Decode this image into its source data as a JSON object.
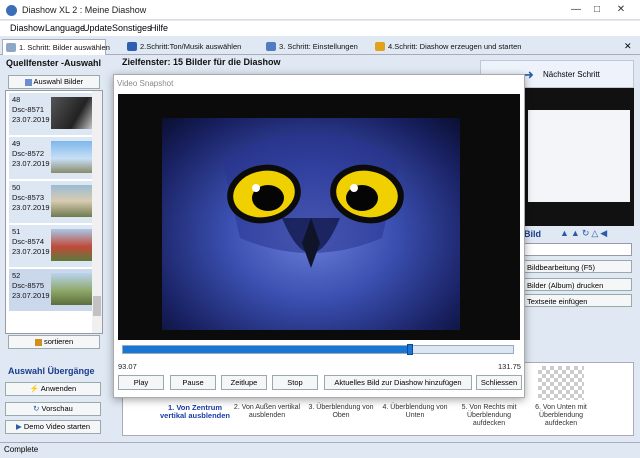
{
  "window": {
    "title": "Diashow XL 2 : Meine Diashow",
    "controls": [
      "minimize-icon",
      "maximize-icon",
      "close-icon"
    ]
  },
  "menu": [
    "Diashow",
    "Language",
    "Update",
    "Sonstiges",
    "Hilfe"
  ],
  "tabs": [
    {
      "label": "1. Schritt: Bilder auswählen",
      "active": true
    },
    {
      "label": "2.Schritt:Ton/Musik auswählen",
      "active": false
    },
    {
      "label": "3. Schritt: Einstellungen",
      "active": false
    },
    {
      "label": "4.Schritt: Diashow erzeugen und starten",
      "active": false
    }
  ],
  "left": {
    "heading": "Quellfenster -Auswahl",
    "select_button": "Auswahl Bilder",
    "items": [
      {
        "num": "48",
        "name": "Dsc-8571",
        "date": "23.07.2019"
      },
      {
        "num": "49",
        "name": "Dsc-8572",
        "date": "23.07.2019"
      },
      {
        "num": "50",
        "name": "Dsc-8573",
        "date": "23.07.2019"
      },
      {
        "num": "51",
        "name": "Dsc-8574",
        "date": "23.07.2019"
      },
      {
        "num": "52",
        "name": "Dsc-8575",
        "date": "23.07.2019"
      }
    ],
    "sort_button": "sortieren"
  },
  "target": {
    "heading": "Zielfenster: 15 Bilder für die Diashow"
  },
  "right": {
    "next_step": "Nächster Schritt",
    "bild_label": "Bild",
    "buttons": [
      "Bildbearbeitung (F5)",
      "Bilder (Album) drucken",
      "Textseite einfügen"
    ]
  },
  "dialog": {
    "title": "Video Snapshot",
    "time_start": "93.07",
    "time_end": "131.75",
    "progress": 0.735,
    "buttons": [
      "Play",
      "Pause",
      "Zeitlupe",
      "Stop",
      "Aktuelles Bild zur Diashow hinzufügen",
      "Schliessen"
    ]
  },
  "transitions": {
    "heading": "Auswahl Übergänge",
    "apply_button": "Anwenden",
    "preview_button": "Vorschau",
    "demo_button": "Demo Video starten",
    "items": [
      {
        "label": "1. Von Zentrum vertikal ausblenden",
        "active": true
      },
      {
        "label": "2. Von Außen vertikal ausblenden",
        "active": false
      },
      {
        "label": "3. Überblendung von Oben",
        "active": false
      },
      {
        "label": "4. Überblendung von Unten",
        "active": false
      },
      {
        "label": "5. Von Rechts mit Überblendung aufdecken",
        "active": false
      },
      {
        "label": "6. Von Unten mit Überblendung aufdecken",
        "active": false
      }
    ]
  },
  "status": {
    "text": "Complete"
  },
  "colors": {
    "accent": "#1976d2",
    "panel": "#dfe8f3",
    "heading_blue": "#1b3c8a"
  }
}
